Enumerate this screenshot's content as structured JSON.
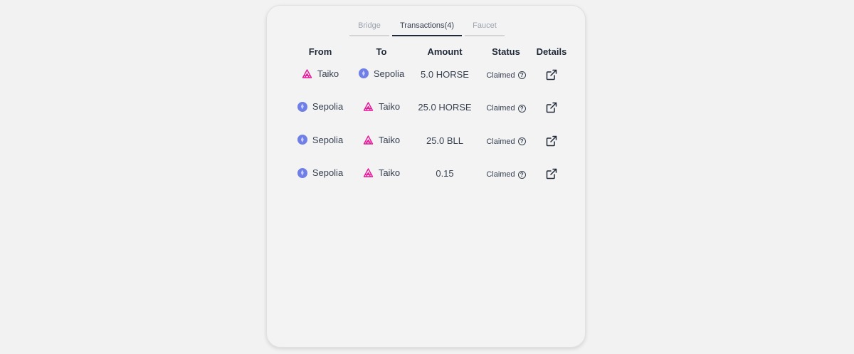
{
  "tabs": [
    {
      "label": "Bridge",
      "active": false
    },
    {
      "label": "Transactions(4)",
      "active": true
    },
    {
      "label": "Faucet",
      "active": false
    }
  ],
  "table": {
    "headers": [
      "From",
      "To",
      "Amount",
      "Status",
      "Details"
    ],
    "rows": [
      {
        "from": "Taiko",
        "from_icon": "taiko-icon",
        "to": "Sepolia",
        "to_icon": "ethereum-icon",
        "amount": "5.0 HORSE",
        "status": "Claimed"
      },
      {
        "from": "Sepolia",
        "from_icon": "ethereum-icon",
        "to": "Taiko",
        "to_icon": "taiko-icon",
        "amount": "25.0 HORSE",
        "status": "Claimed"
      },
      {
        "from": "Sepolia",
        "from_icon": "ethereum-icon",
        "to": "Taiko",
        "to_icon": "taiko-icon",
        "amount": "25.0 BLL",
        "status": "Claimed"
      },
      {
        "from": "Sepolia",
        "from_icon": "ethereum-icon",
        "to": "Taiko",
        "to_icon": "taiko-icon",
        "amount": "0.15",
        "status": "Claimed"
      }
    ]
  },
  "colors": {
    "taiko": "#e81899",
    "ethereum": "#6f7fe5",
    "active_tab": "#1f2937"
  }
}
